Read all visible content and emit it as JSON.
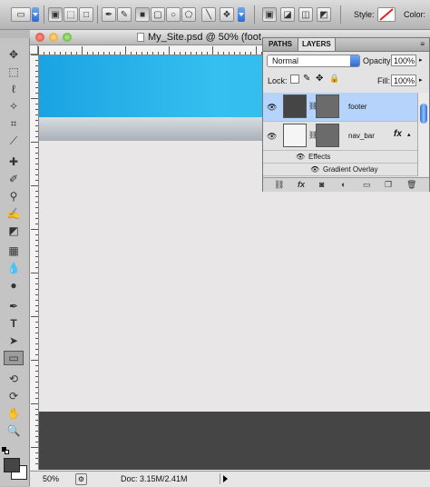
{
  "options_bar": {
    "style_label": "Style:",
    "color_label": "Color:",
    "tool_icons": [
      "rectangle-marquee-preset-icon",
      "shape-layers-icon",
      "paths-icon",
      "fill-pixels-icon",
      "pen-icon",
      "freeform-pen-icon",
      "rectangle-icon",
      "rounded-rectangle-icon",
      "ellipse-icon",
      "polygon-icon",
      "line-icon",
      "custom-shape-icon",
      "combine-add-icon",
      "combine-subtract-icon",
      "combine-intersect-icon",
      "combine-exclude-icon"
    ]
  },
  "document": {
    "title": "My_Site.psd @ 50% (foot",
    "zoom": "50%",
    "doc_info": "Doc: 3.15M/2.41M",
    "colors": {
      "banner": "#2ab4ea",
      "navbar": "#c3c9cf",
      "canvas": "#e9e6e7",
      "footer": "#454545"
    }
  },
  "toolbox": {
    "tools": [
      "move",
      "marquee",
      "lasso",
      "magic-wand",
      "crop",
      "eyedropper",
      "healing-brush",
      "brush",
      "clone-stamp",
      "history-brush",
      "eraser",
      "gradient",
      "blur",
      "dodge",
      "pen",
      "type",
      "path-selection",
      "rectangle-shape",
      "3d-rotate",
      "3d-orbit",
      "hand",
      "zoom"
    ]
  },
  "layers_panel": {
    "tabs": [
      "PATHS",
      "LAYERS"
    ],
    "active_tab": "LAYERS",
    "blend_mode": "Normal",
    "opacity_label": "Opacity:",
    "opacity": "100%",
    "lock_label": "Lock:",
    "fill_label": "Fill:",
    "fill": "100%",
    "layers": [
      {
        "name": "footer",
        "selected": true
      },
      {
        "name": "nav_bar",
        "selected": false,
        "fx": "fx"
      }
    ],
    "effects_label": "Effects",
    "effect_item": "Gradient Overlay"
  }
}
